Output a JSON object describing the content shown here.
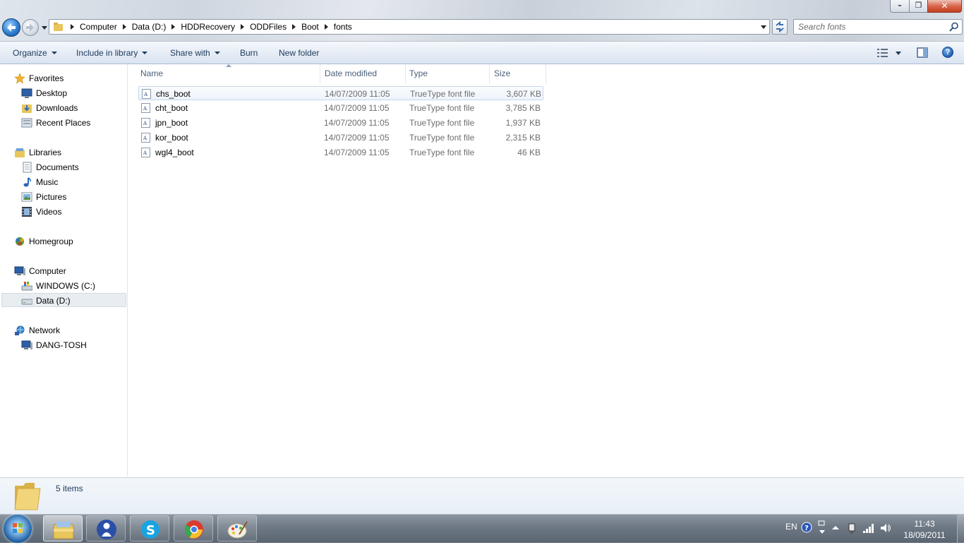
{
  "window": {
    "minimize_glyph": "–",
    "maximize_glyph": "❐",
    "close_glyph": "✕"
  },
  "address": {
    "crumbs": [
      "Computer",
      "Data (D:)",
      "HDDRecovery",
      "ODDFiles",
      "Boot",
      "fonts"
    ]
  },
  "search": {
    "placeholder": "Search fonts"
  },
  "commands": {
    "organize": "Organize",
    "include_in_library": "Include in library",
    "share_with": "Share with",
    "burn": "Burn",
    "new_folder": "New folder",
    "help": "?"
  },
  "nav": {
    "favorites": "Favorites",
    "desktop": "Desktop",
    "downloads": "Downloads",
    "recent_places": "Recent Places",
    "libraries": "Libraries",
    "documents": "Documents",
    "music": "Music",
    "pictures": "Pictures",
    "videos": "Videos",
    "homegroup": "Homegroup",
    "computer": "Computer",
    "windows_c": "WINDOWS (C:)",
    "data_d": "Data (D:)",
    "network": "Network",
    "dang_tosh": "DANG-TOSH"
  },
  "columns": {
    "name": "Name",
    "date_modified": "Date modified",
    "type": "Type",
    "size": "Size"
  },
  "files": [
    {
      "name": "chs_boot",
      "date": "14/07/2009 11:05",
      "type": "TrueType font file",
      "size": "3,607 KB"
    },
    {
      "name": "cht_boot",
      "date": "14/07/2009 11:05",
      "type": "TrueType font file",
      "size": "3,785 KB"
    },
    {
      "name": "jpn_boot",
      "date": "14/07/2009 11:05",
      "type": "TrueType font file",
      "size": "1,937 KB"
    },
    {
      "name": "kor_boot",
      "date": "14/07/2009 11:05",
      "type": "TrueType font file",
      "size": "2,315 KB"
    },
    {
      "name": "wgl4_boot",
      "date": "14/07/2009 11:05",
      "type": "TrueType font file",
      "size": "46 KB"
    }
  ],
  "details": {
    "item_count": "5 items"
  },
  "taskbar": {
    "language": "EN",
    "time": "11:43",
    "date": "18/09/2011",
    "pinned": [
      "windows-explorer-icon",
      "user-accounts-icon",
      "skype-icon",
      "chrome-icon",
      "paint-icon"
    ]
  },
  "colors": {
    "accent": "#1e395b",
    "selection_border": "#c4d7ec",
    "secondary_text": "#6d6d6d"
  }
}
